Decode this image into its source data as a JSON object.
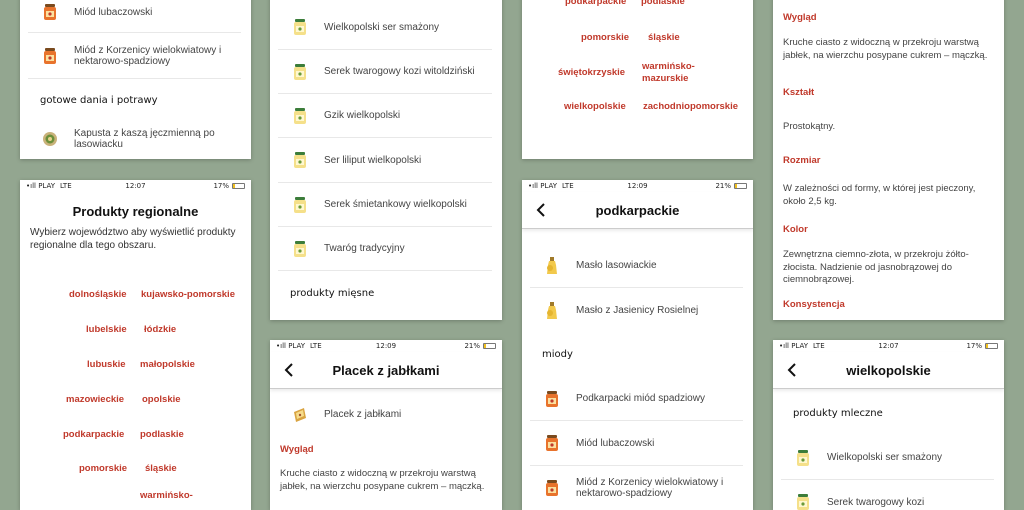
{
  "colors": {
    "accent": "#c0392b",
    "background": "#93a690"
  },
  "status": {
    "carrier": "PLAY LTE",
    "carrier_a": "•ıll PLAY",
    "lte": "LTE",
    "t1207": "12:07",
    "t1209": "12:09",
    "b17": "17%",
    "b21": "21%"
  },
  "p1": {
    "items": [
      "Miód lubaczowski",
      "Miód z Korzenicy wielokwiatowy i nektarowo-spadziowy"
    ],
    "section": "gotowe dania i potrawy",
    "dish": "Kapusta z kaszą jęczmienną po lasowiacku"
  },
  "p2": {
    "items": [
      "Wielkopolski ser smażony",
      "Serek twarogowy kozi witoldziński",
      "Gzik wielkopolski",
      "Ser liliput wielkopolski",
      "Serek śmietankowy wielkopolski",
      "Twaróg tradycyjny"
    ],
    "section": "produkty mięsne"
  },
  "p3": {
    "regions": [
      "podkarpackie",
      "podlaskie",
      "pomorskie",
      "śląskie",
      "świętokrzyskie",
      "warmińsko-mazurskie",
      "wielkopolskie",
      "zachodniopomorskie"
    ]
  },
  "p4": {
    "wyglad_text": "Kruche ciasto z widoczną w przekroju warstwą jabłek, na wierzchu posypane cukrem – mączką.",
    "ksztalt": "Kształt",
    "ksztalt_text": "Prostokątny.",
    "rozmiar": "Rozmiar",
    "rozmiar_text": "W zależności od formy, w której jest pieczony, około 2,5 kg.",
    "kolor": "Kolor",
    "kolor_text": "Zewnętrzna ciemno-złota, w przekroju żółto-złocista. Nadzienie od jasnobrązowej do ciemnobrązowej.",
    "konsystencja": "Konsystencja",
    "wyglad": "Wygląd"
  },
  "p5": {
    "title": "Produkty regionalne",
    "desc": "Wybierz województwo aby wyświetlić produkty regionalne dla tego obszaru.",
    "regions": [
      "dolnośląskie",
      "kujawsko-pomorskie",
      "lubelskie",
      "łódzkie",
      "lubuskie",
      "małopolskie",
      "mazowieckie",
      "opolskie",
      "podkarpackie",
      "podlaskie",
      "pomorskie",
      "śląskie",
      "warmińsko-"
    ]
  },
  "p6": {
    "title": "Placek z jabłkami",
    "item": "Placek z jabłkami",
    "wyglad": "Wygląd",
    "wyglad_text": "Kruche ciasto z widoczną w przekroju warstwą jabłek, na wierzchu posypane cukrem – mączką."
  },
  "p7": {
    "title": "podkarpackie",
    "items": [
      "Masło lasowiackie",
      "Masło z Jasienicy Rosielnej"
    ],
    "section": "miody",
    "honey": [
      "Podkarpacki miód spadziowy",
      "Miód lubaczowski",
      "Miód z Korzenicy wielokwiatowy i nektarowo-spadziowy"
    ]
  },
  "p8": {
    "title": "wielkopolskie",
    "section": "produkty mleczne",
    "items": [
      "Wielkopolski ser smażony",
      "Serek twarogowy kozi"
    ]
  }
}
